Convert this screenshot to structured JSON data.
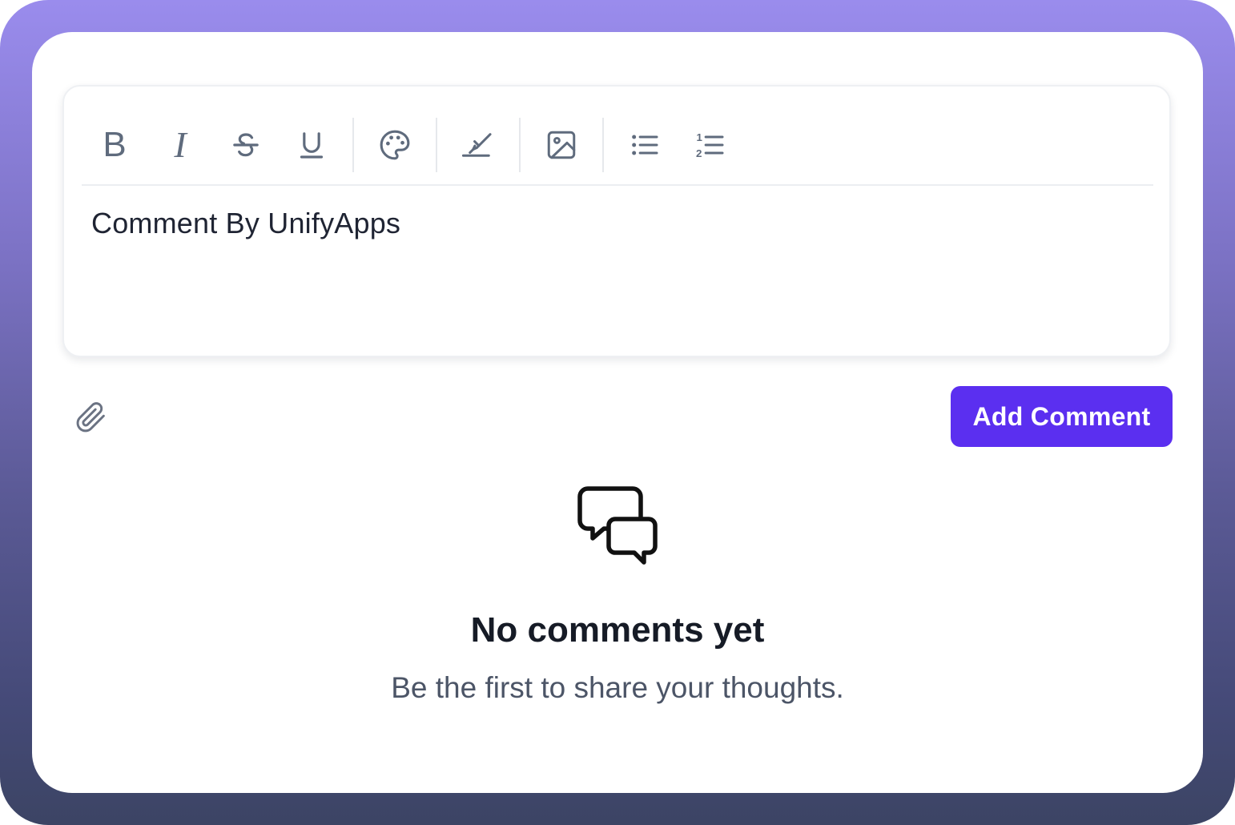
{
  "editor": {
    "toolbar": {
      "bold": "B",
      "italic": "I",
      "icons": [
        "strikethrough-icon",
        "underline-icon",
        "palette-icon",
        "highlighter-icon",
        "image-icon",
        "bullet-list-icon",
        "numbered-list-icon"
      ]
    },
    "content": "Comment By UnifyApps"
  },
  "actions": {
    "attach_icon": "paperclip-icon",
    "add_comment_label": "Add Comment"
  },
  "empty_state": {
    "icon": "chat-bubbles-icon",
    "title": "No comments yet",
    "subtitle": "Be the first to share your thoughts."
  },
  "colors": {
    "accent": "#5b2ff0",
    "toolbar_icon": "#5f6b7d",
    "frame_top": "#9a8ced",
    "frame_bottom": "#3c4464"
  }
}
